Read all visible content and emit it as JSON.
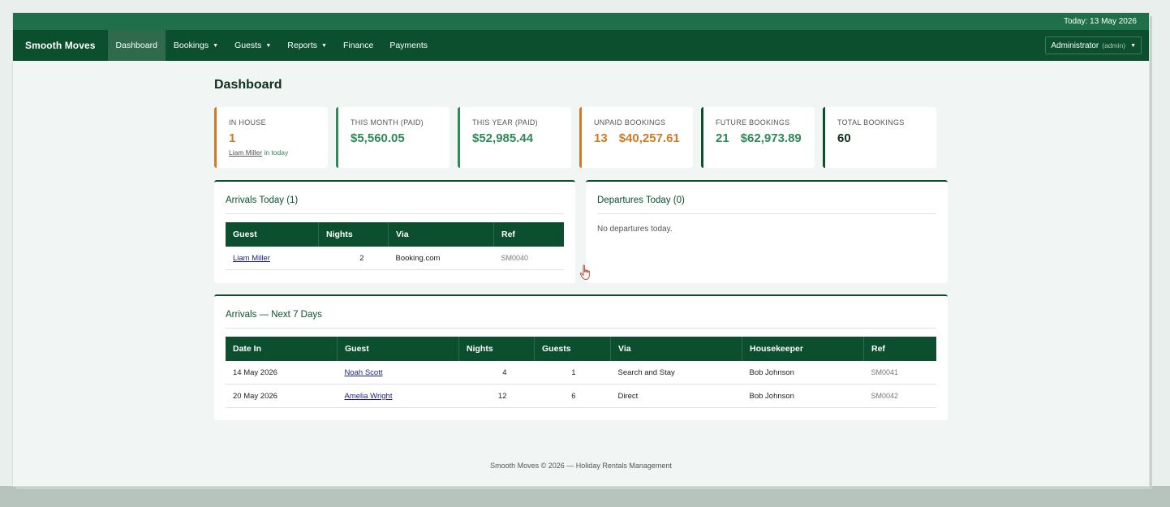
{
  "topbar": {
    "today": "Today: 13 May 2026"
  },
  "nav": {
    "brand": "Smooth Moves",
    "items": [
      {
        "label": "Dashboard",
        "active": true
      },
      {
        "label": "Bookings",
        "dropdown": true
      },
      {
        "label": "Guests",
        "dropdown": true
      },
      {
        "label": "Reports",
        "dropdown": true
      },
      {
        "label": "Finance"
      },
      {
        "label": "Payments"
      }
    ],
    "user": {
      "name": "Administrator",
      "role": "(admin)"
    }
  },
  "page": {
    "title": "Dashboard"
  },
  "stats": {
    "in_house": {
      "label": "IN HOUSE",
      "value": "1",
      "sub_link": "Liam Miller",
      "sub_text": " in today"
    },
    "this_month": {
      "label": "THIS MONTH (PAID)",
      "value": "$5,560.05"
    },
    "this_year": {
      "label": "THIS YEAR (PAID)",
      "value": "$52,985.44"
    },
    "unpaid": {
      "label": "UNPAID BOOKINGS",
      "count": "13",
      "amount": "$40,257.61"
    },
    "future": {
      "label": "FUTURE BOOKINGS",
      "count": "21",
      "amount": "$62,973.89"
    },
    "total": {
      "label": "TOTAL BOOKINGS",
      "value": "60"
    }
  },
  "arrivals_today": {
    "title": "Arrivals Today (1)",
    "columns": [
      "Guest",
      "Nights",
      "Via",
      "Ref"
    ],
    "rows": [
      {
        "guest": "Liam Miller",
        "nights": "2",
        "via": "Booking.com",
        "ref": "SM0040"
      }
    ]
  },
  "departures_today": {
    "title": "Departures Today (0)",
    "empty": "No departures today."
  },
  "arrivals_week": {
    "title": "Arrivals — Next 7 Days",
    "columns": [
      "Date In",
      "Guest",
      "Nights",
      "Guests",
      "Via",
      "Housekeeper",
      "Ref"
    ],
    "rows": [
      {
        "date_in": "14 May 2026",
        "guest": "Noah Scott",
        "nights": "4",
        "guests": "1",
        "via": "Search and Stay",
        "housekeeper": "Bob Johnson",
        "ref": "SM0041"
      },
      {
        "date_in": "20 May 2026",
        "guest": "Amelia Wright",
        "nights": "12",
        "guests": "6",
        "via": "Direct",
        "housekeeper": "Bob Johnson",
        "ref": "SM0042"
      }
    ]
  },
  "footer": {
    "text": "Smooth Moves © 2026 — Holiday Rentals Management"
  },
  "icons": {
    "cursor": "hand-pointer-icon",
    "dropdown": "caret-down-icon"
  },
  "colors": {
    "brand_dark": "#0b4f2e",
    "accent_green": "#2e8a58",
    "accent_orange": "#cf7a25"
  }
}
